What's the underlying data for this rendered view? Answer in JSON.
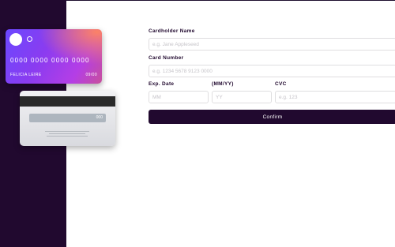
{
  "card_front": {
    "number": "0000 0000 0000 0000",
    "holder": "FELICIA LEIRE",
    "expiry": "09/00"
  },
  "card_back": {
    "cvc": "000"
  },
  "form": {
    "name_label": "Cardholder Name",
    "name_placeholder": "e.g. Jane Appleseed",
    "number_label": "Card Number",
    "number_placeholder": "e.g. 1234 5678 9123 0000",
    "exp_label": "Exp. Date",
    "mmyy_label": "(MM/YY)",
    "cvc_label": "CVC",
    "mm_placeholder": "MM",
    "yy_placeholder": "YY",
    "cvc_placeholder": "e.g. 123",
    "confirm_label": "Confirm"
  },
  "colors": {
    "sidebar": "#21092f",
    "accent_dark": "#21092f",
    "input_border": "#dfdee0",
    "placeholder": "#c6c4c9"
  }
}
